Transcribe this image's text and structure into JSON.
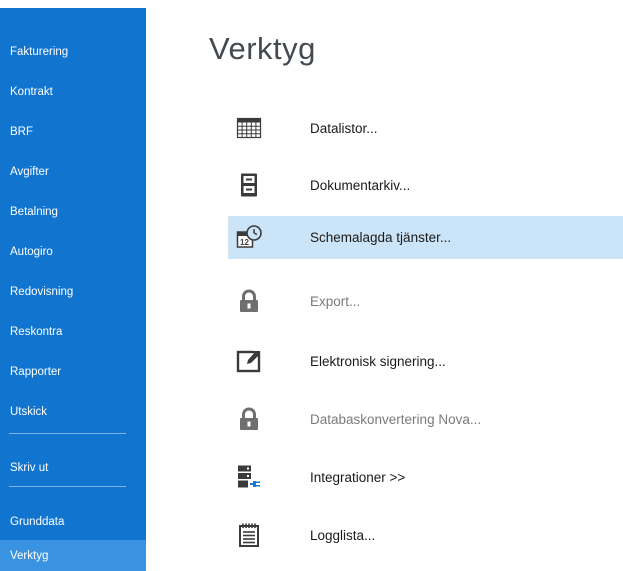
{
  "sidebar": {
    "items": [
      {
        "label": "Fakturering"
      },
      {
        "label": "Kontrakt"
      },
      {
        "label": "BRF"
      },
      {
        "label": "Avgifter"
      },
      {
        "label": "Betalning"
      },
      {
        "label": "Autogiro"
      },
      {
        "label": "Redovisning"
      },
      {
        "label": "Reskontra"
      },
      {
        "label": "Rapporter"
      },
      {
        "label": "Utskick"
      },
      {
        "label": "Skriv ut"
      },
      {
        "label": "Grunddata"
      },
      {
        "label": "Verktyg"
      }
    ],
    "active": "Verktyg"
  },
  "main": {
    "title": "Verktyg",
    "tools": [
      {
        "label": "Datalistor...",
        "icon": "table-grid-icon",
        "state": "enabled"
      },
      {
        "label": "Dokumentarkiv...",
        "icon": "file-cabinet-icon",
        "state": "enabled"
      },
      {
        "label": "Schemalagda tjänster...",
        "icon": "scheduled-calendar-icon",
        "state": "highlighted"
      },
      {
        "label": "Export...",
        "icon": "lock-icon",
        "state": "disabled"
      },
      {
        "label": "Elektronisk signering...",
        "icon": "edit-sign-icon",
        "state": "enabled"
      },
      {
        "label": "Databaskonvertering Nova...",
        "icon": "lock-icon",
        "state": "disabled"
      },
      {
        "label": "Integrationer >>",
        "icon": "server-plug-icon",
        "state": "enabled"
      },
      {
        "label": "Logglista...",
        "icon": "log-list-icon",
        "state": "enabled"
      }
    ]
  },
  "colors": {
    "sidebar_bg": "#1175cf",
    "sidebar_active": "#3a93e0",
    "highlight_row": "#cce4f7",
    "icon_dark": "#3b3b3b",
    "icon_disabled": "#6f6f6f",
    "plug_blue": "#1e78d2"
  }
}
